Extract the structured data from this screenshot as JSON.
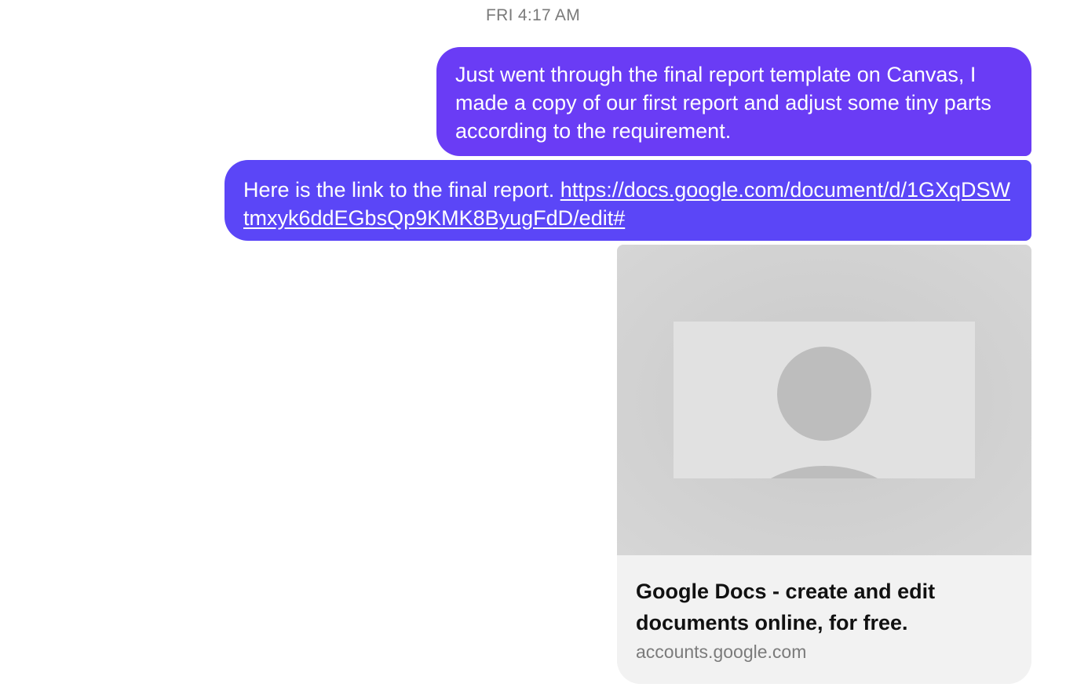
{
  "conversation": {
    "timestamp": "FRI 4:17 AM",
    "messages": [
      {
        "text": "Just went through the final report template on Canvas, I made a copy of our first report and adjust some tiny parts according to the requirement."
      },
      {
        "prefix": "Here is the link to the final report. ",
        "link_text": "https://docs.google.com/document/d/1GXqDSWtmxyk6ddEGbsQp9KMK8ByugFdD/edit#"
      }
    ],
    "link_preview": {
      "image_icon": "avatar-placeholder-icon",
      "title": "Google Docs - create and edit documents online, for free.",
      "domain": "accounts.google.com"
    }
  },
  "colors": {
    "bubble_primary": "#6a3cf5",
    "bubble_secondary": "#5b46f7",
    "card_background": "#f2f2f2",
    "timestamp_text": "#7a7a7a"
  }
}
